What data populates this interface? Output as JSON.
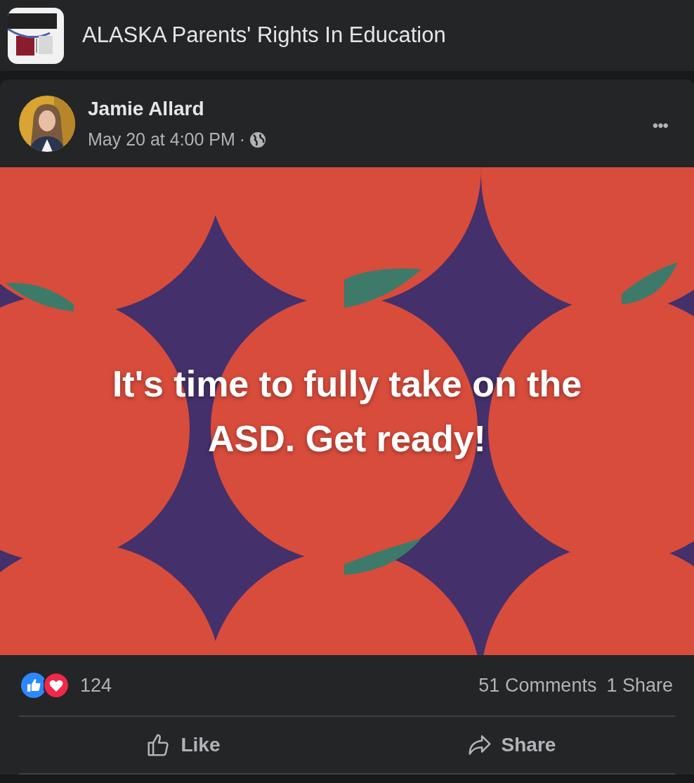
{
  "page": {
    "name": "ALASKA Parents' Rights In Education"
  },
  "post": {
    "author": "Jamie Allard",
    "time": "May 20 at 4:00 PM",
    "separator": "·",
    "more": "•••",
    "text": "It's time to fully take on the ASD. Get ready!"
  },
  "stats": {
    "reactions_count": "124",
    "comments": "51 Comments",
    "shares": "1 Share"
  },
  "actions": [
    {
      "kind": "like",
      "label": "Like"
    },
    {
      "kind": "share",
      "label": "Share"
    }
  ]
}
